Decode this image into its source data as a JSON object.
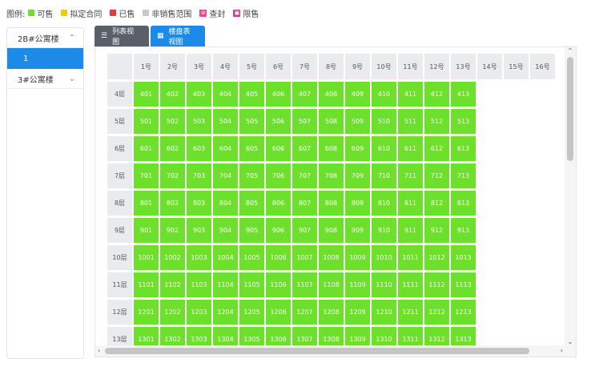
{
  "legend": {
    "label": "图例:",
    "items": [
      {
        "name": "可售",
        "color": "#6ce02a",
        "icon": ""
      },
      {
        "name": "拟定合同",
        "color": "#f2c811",
        "icon": ""
      },
      {
        "name": "已售",
        "color": "#e23b3b",
        "icon": ""
      },
      {
        "name": "非销售范围",
        "color": "#c8c8c8",
        "icon": ""
      },
      {
        "name": "查封",
        "color": "#e8488f",
        "icon": "⊘"
      },
      {
        "name": "限售",
        "color": "#c03b8f",
        "icon": "▣"
      }
    ]
  },
  "sidebar": {
    "buildings": [
      {
        "name": "2B#公寓楼",
        "expanded": true,
        "units": [
          "1"
        ]
      },
      {
        "name": "3#公寓楼",
        "expanded": false,
        "units": []
      }
    ]
  },
  "tabs": [
    {
      "label": "列表视图",
      "icon": "list-icon",
      "active": false
    },
    {
      "label": "楼盘表视图",
      "icon": "grid-icon",
      "active": true
    }
  ],
  "grid": {
    "columns": [
      "1号",
      "2号",
      "3号",
      "4号",
      "5号",
      "6号",
      "7号",
      "8号",
      "9号",
      "10号",
      "11号",
      "12号",
      "13号",
      "14号",
      "15号",
      "16号"
    ],
    "rows": [
      {
        "label": "4层",
        "rooms": [
          "401",
          "402",
          "403",
          "404",
          "405",
          "406",
          "407",
          "408",
          "409",
          "410",
          "411",
          "412",
          "413"
        ]
      },
      {
        "label": "5层",
        "rooms": [
          "501",
          "502",
          "503",
          "504",
          "505",
          "506",
          "507",
          "508",
          "509",
          "510",
          "511",
          "512",
          "513"
        ]
      },
      {
        "label": "6层",
        "rooms": [
          "601",
          "602",
          "603",
          "604",
          "605",
          "606",
          "607",
          "608",
          "609",
          "610",
          "611",
          "612",
          "613"
        ]
      },
      {
        "label": "7层",
        "rooms": [
          "701",
          "702",
          "703",
          "704",
          "705",
          "706",
          "707",
          "708",
          "709",
          "710",
          "711",
          "712",
          "713"
        ]
      },
      {
        "label": "8层",
        "rooms": [
          "801",
          "802",
          "803",
          "804",
          "805",
          "806",
          "807",
          "808",
          "809",
          "810",
          "811",
          "812",
          "813"
        ]
      },
      {
        "label": "9层",
        "rooms": [
          "901",
          "902",
          "903",
          "904",
          "905",
          "906",
          "907",
          "908",
          "909",
          "910",
          "911",
          "912",
          "913"
        ]
      },
      {
        "label": "10层",
        "rooms": [
          "1001",
          "1002",
          "1003",
          "1004",
          "1005",
          "1006",
          "1007",
          "1008",
          "1009",
          "1010",
          "1011",
          "1012",
          "1013"
        ]
      },
      {
        "label": "11层",
        "rooms": [
          "1101",
          "1102",
          "1103",
          "1104",
          "1105",
          "1106",
          "1107",
          "1108",
          "1109",
          "1110",
          "1111",
          "1112",
          "1113"
        ]
      },
      {
        "label": "12层",
        "rooms": [
          "1201",
          "1202",
          "1203",
          "1204",
          "1205",
          "1206",
          "1207",
          "1208",
          "1209",
          "1210",
          "1211",
          "1212",
          "1213"
        ]
      },
      {
        "label": "13层",
        "rooms": [
          "1301",
          "1302",
          "1303",
          "1304",
          "1305",
          "1306",
          "1307",
          "1308",
          "1309",
          "1310",
          "1311",
          "1312",
          "1313"
        ]
      }
    ]
  }
}
